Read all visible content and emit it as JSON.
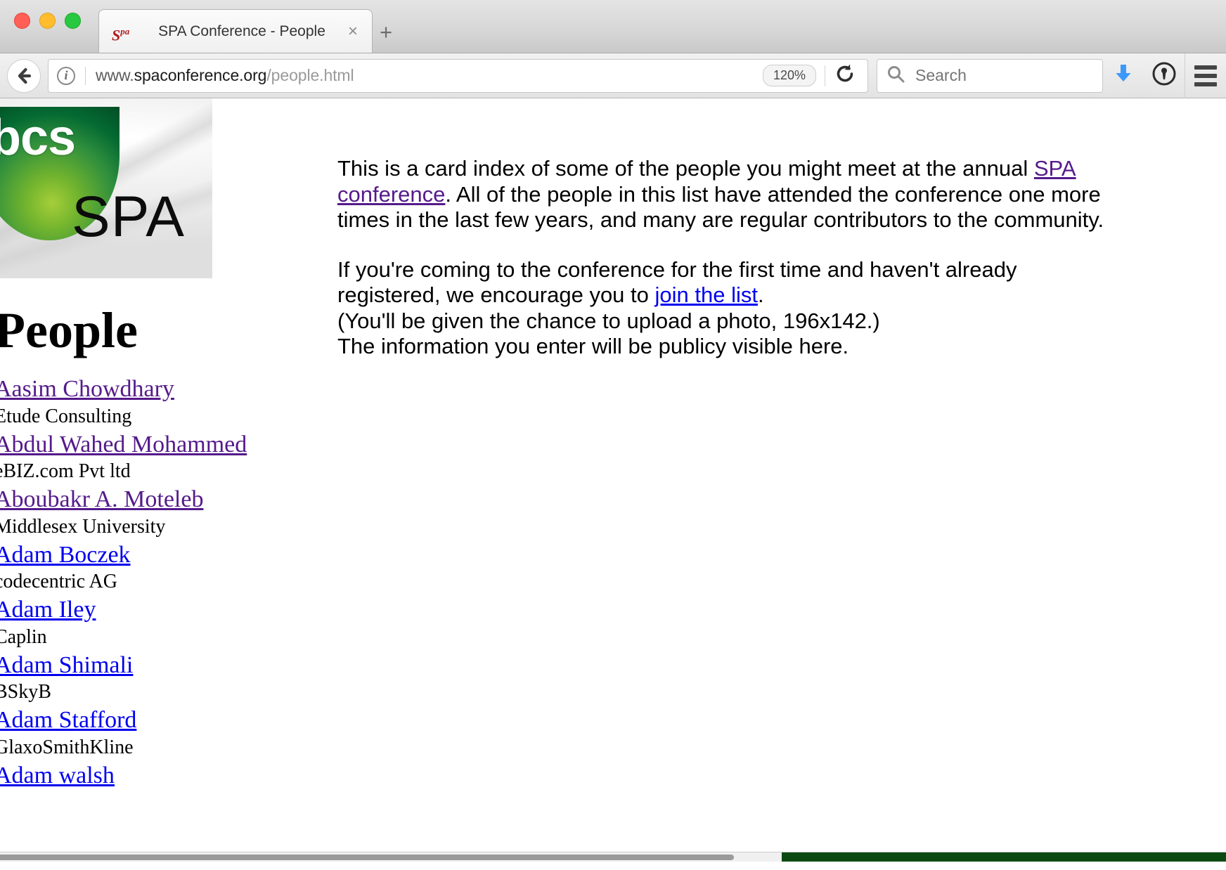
{
  "window": {
    "traffic_lights": [
      "close",
      "minimize",
      "zoom"
    ]
  },
  "tabs": [
    {
      "favicon_label": "S",
      "favicon_sup": "pa",
      "title": "SPA Conference - People",
      "close_label": "×",
      "active": true
    }
  ],
  "newtab_label": "+",
  "toolbar": {
    "back_label": "Back",
    "info_icon_label": "i",
    "url_scheme_host": "www.spaconference.org",
    "url_host_prefix": "www.",
    "url_domain": "spaconference.org",
    "url_path": "/people.html",
    "zoom_level": "120%",
    "reload_label": "Reload",
    "search_placeholder": "Search",
    "search_value": "",
    "downloads_label": "Downloads",
    "password_manager_label": "1Password",
    "menu_label": "Open menu"
  },
  "page": {
    "logo": {
      "bcs_text": "bcs",
      "spa_text": "SPA",
      "alt": "BCS SPA logo"
    },
    "title": "People",
    "intro": {
      "para1_before_link": "This is a card index of some of the people you might meet at the annual ",
      "para1_link": "SPA conference",
      "para1_after_link": ". All of the people in this list have attended the conference one more times in the last few years, and many are regular contributors to the community.",
      "para2_before_link": "If you're coming to the conference for the first time and haven't already registered, we encourage you to ",
      "para2_link": "join the list",
      "para2_after_link": ".",
      "para2_line3": "(You'll be given the chance to upload a photo, 196x142.)",
      "para2_line4": "The information you enter will be publicy visible here."
    },
    "people": [
      {
        "name": "Aasim Chowdhary",
        "org": "Etude Consulting",
        "visited": true
      },
      {
        "name": "Abdul Wahed Mohammed",
        "org": "eBIZ.com Pvt ltd",
        "visited": true
      },
      {
        "name": "Aboubakr A. Moteleb",
        "org": "Middlesex University",
        "visited": true
      },
      {
        "name": "Adam Boczek",
        "org": "codecentric AG",
        "visited": false
      },
      {
        "name": "Adam Iley",
        "org": "Caplin",
        "visited": false
      },
      {
        "name": "Adam Shimali",
        "org": "BSkyB",
        "visited": false
      },
      {
        "name": "Adam Stafford",
        "org": "GlaxoSmithKline",
        "visited": false
      },
      {
        "name": "Adam walsh",
        "org": "",
        "visited": false
      }
    ]
  },
  "colors": {
    "link_visited": "#551a8b",
    "link_unvisited": "#0000ee",
    "download_arrow": "#3b99fc",
    "bcs_green_dark": "#046a32",
    "bcs_green_light": "#a6ce39"
  }
}
